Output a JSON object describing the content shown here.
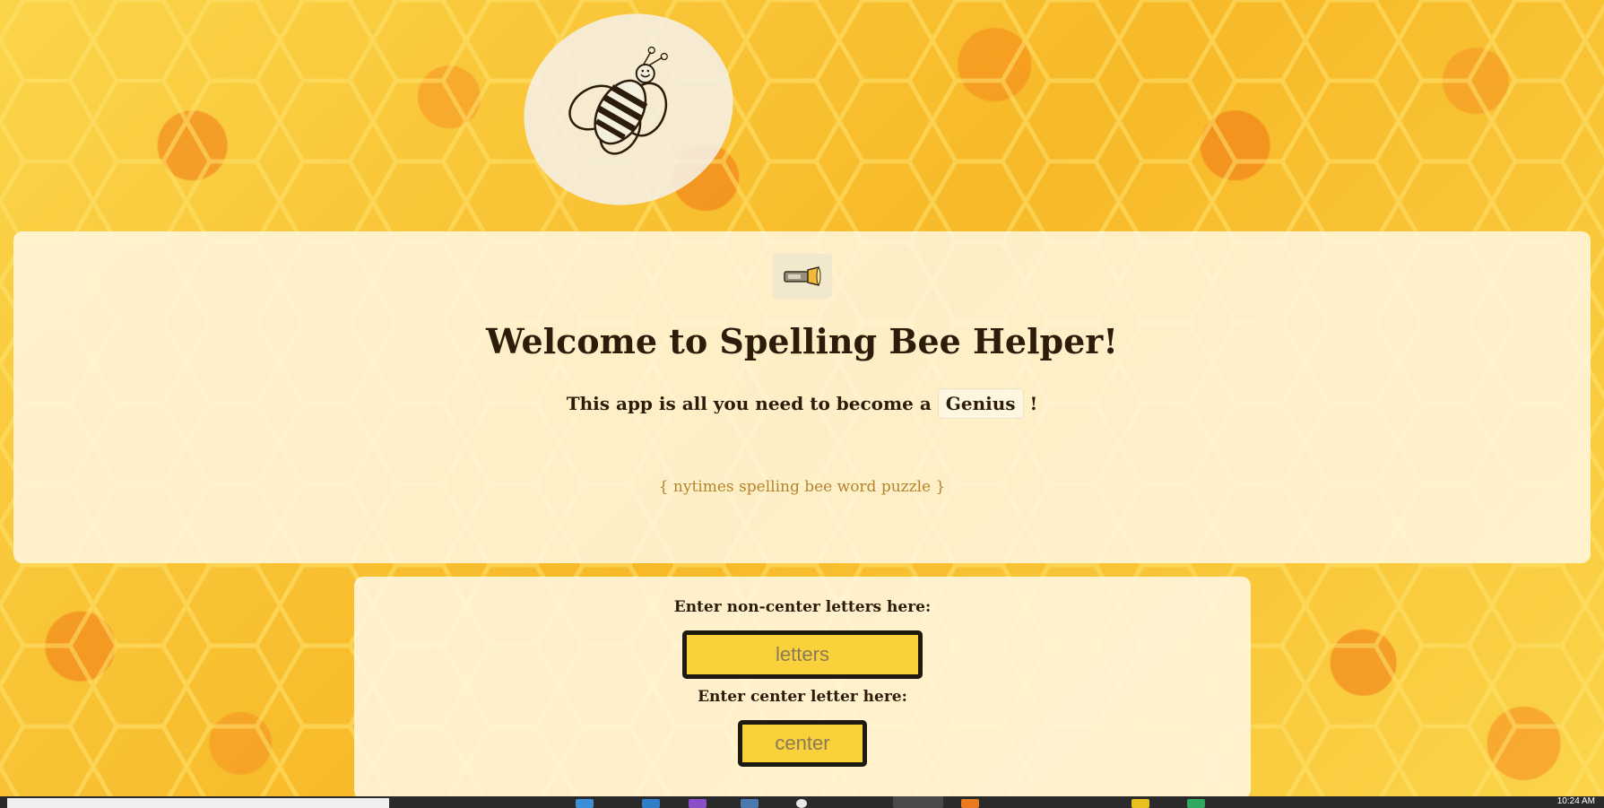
{
  "app": {
    "title": "Welcome to Spelling Bee Helper!",
    "subtitle_prefix": "This app is all you need to become a",
    "subtitle_badge": "Genius",
    "subtitle_suffix": "!",
    "tagline": "{ nytimes spelling bee word puzzle }"
  },
  "icons": {
    "logo": "bee-logo-icon",
    "flashlight": "flashlight-icon"
  },
  "form": {
    "noncenter_label": "Enter non-center letters here:",
    "noncenter_placeholder": "letters",
    "center_label": "Enter center letter here:",
    "center_placeholder": "center"
  },
  "taskbar": {
    "clock": "10:24 AM"
  },
  "colors": {
    "background": "#f8c22e",
    "honeycomb_orange": "#f07814",
    "panel": "#fff7e1",
    "input_fill": "#f9d13a",
    "input_border": "#1e1a10",
    "tagline": "#b5842a",
    "text": "#2b1d0a"
  }
}
